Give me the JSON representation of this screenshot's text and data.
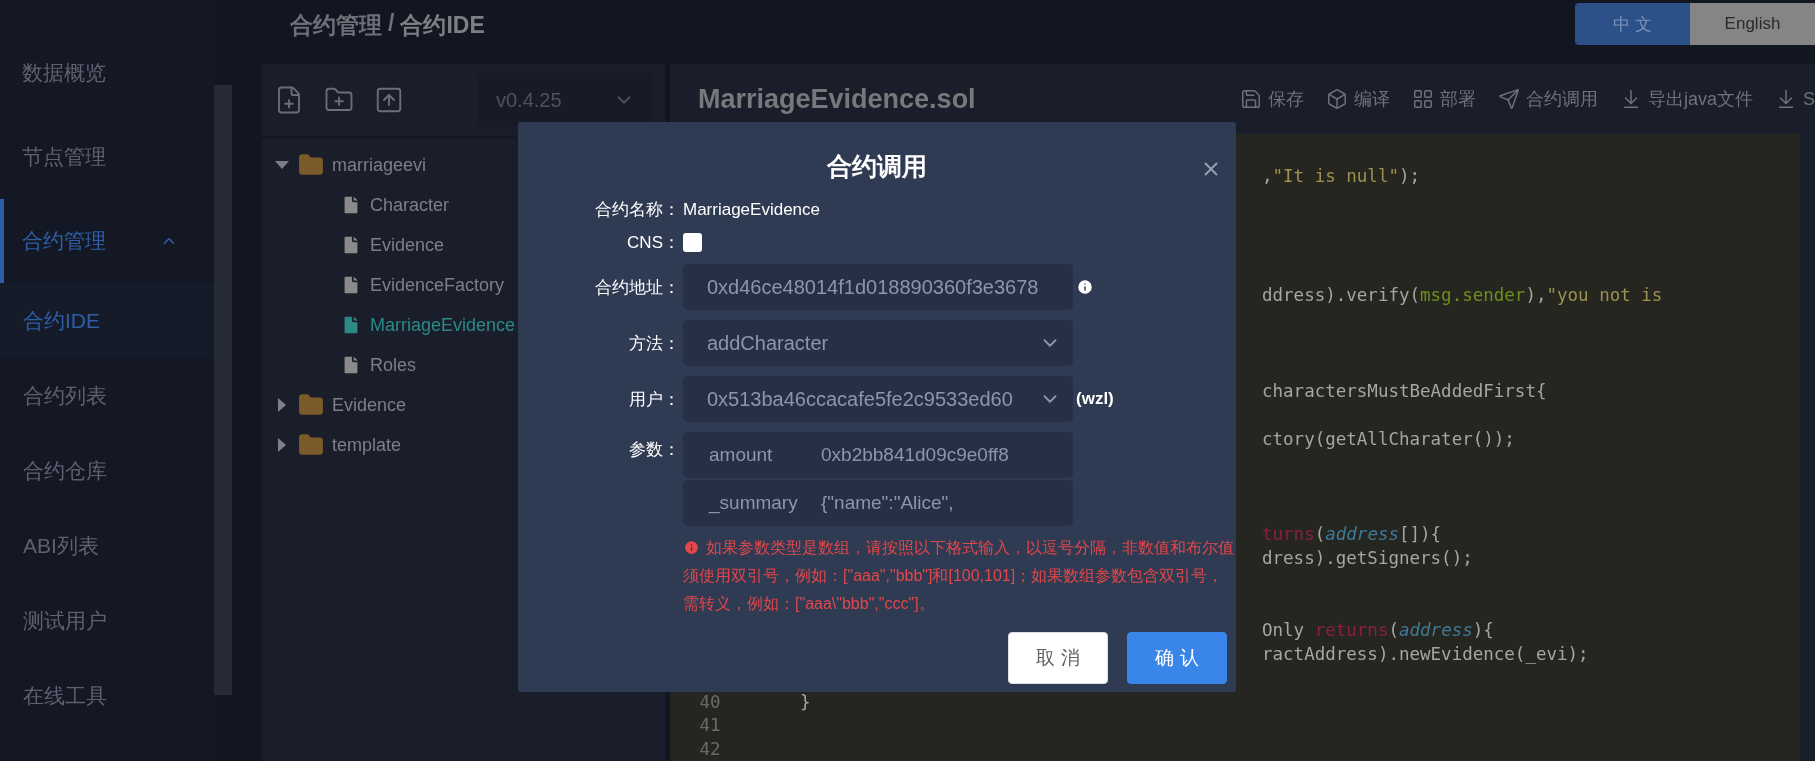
{
  "breadcrumb": {
    "parent": "合约管理",
    "separator": "/",
    "current": "合约IDE"
  },
  "language_switch": [
    {
      "label": "中 文",
      "selected": true
    },
    {
      "label": "English",
      "selected": false
    }
  ],
  "sidebar": {
    "items": [
      {
        "label": "数据概览",
        "kind": "item",
        "selected": false
      },
      {
        "label": "节点管理",
        "kind": "item",
        "selected": false
      },
      {
        "label": "合约管理",
        "kind": "group",
        "selected": true,
        "expanded": true,
        "children": [
          {
            "label": "合约IDE",
            "selected": true
          },
          {
            "label": "合约列表",
            "selected": false
          },
          {
            "label": "合约仓库",
            "selected": false
          },
          {
            "label": "ABI列表",
            "selected": false
          },
          {
            "label": "测试用户",
            "selected": false
          },
          {
            "label": "在线工具",
            "selected": false
          }
        ]
      }
    ]
  },
  "file_panel": {
    "version": "v0.4.25",
    "tree": [
      {
        "name": "marriageevi",
        "kind": "folder",
        "expanded": true,
        "selected": false,
        "children": [
          {
            "name": "Character",
            "kind": "file",
            "selected": false
          },
          {
            "name": "Evidence",
            "kind": "file",
            "selected": false
          },
          {
            "name": "EvidenceFactory",
            "kind": "file",
            "selected": false
          },
          {
            "name": "MarriageEvidence",
            "kind": "file",
            "selected": true
          },
          {
            "name": "Roles",
            "kind": "file",
            "selected": false
          }
        ]
      },
      {
        "name": "Evidence",
        "kind": "folder",
        "expanded": false,
        "selected": false
      },
      {
        "name": "template",
        "kind": "folder",
        "expanded": false,
        "selected": false
      }
    ]
  },
  "editor": {
    "title": "MarriageEvidence.sol",
    "toolbar": [
      "保存",
      "编译",
      "部署",
      "合约调用",
      "导出java文件",
      "S"
    ],
    "code_lines": [
      {
        "kind": "clipped",
        "segments": [
          {
            "kind": "plain",
            "text": ","
          },
          {
            "kind": "string",
            "text": "\"It is null\""
          },
          {
            "kind": "plain",
            "text": ");"
          }
        ]
      },
      {
        "kind": "clipped",
        "segments": [
          {
            "kind": "plain",
            "text": "ddress).verify("
          },
          {
            "kind": "var",
            "text": "msg.sender"
          },
          {
            "kind": "plain",
            "text": "),"
          },
          {
            "kind": "string",
            "text": "\"you not is"
          }
        ]
      },
      {
        "kind": "clipped",
        "segments": [
          {
            "kind": "plain",
            "text": "charactersMustBeAddedFirst{"
          }
        ]
      },
      {
        "kind": "clipped",
        "segments": [
          {
            "kind": "plain",
            "text": "ctory(getAllCharater());"
          }
        ]
      },
      {
        "kind": "clipped",
        "segments": [
          {
            "kind": "keyword",
            "text": "turns"
          },
          {
            "kind": "plain",
            "text": "("
          },
          {
            "kind": "type",
            "text": "address"
          },
          {
            "kind": "plain",
            "text": "[]){"
          }
        ]
      },
      {
        "kind": "clipped",
        "segments": [
          {
            "kind": "plain",
            "text": "dress).getSigners();"
          }
        ]
      },
      {
        "kind": "clipped",
        "segments": [
          {
            "kind": "plain",
            "text": "Only "
          },
          {
            "kind": "keyword",
            "text": "returns"
          },
          {
            "kind": "plain",
            "text": "("
          },
          {
            "kind": "type",
            "text": "address"
          },
          {
            "kind": "plain",
            "text": "){"
          }
        ]
      },
      {
        "kind": "clipped",
        "segments": [
          {
            "kind": "plain",
            "text": "ractAddress).newEvidence(_evi);"
          }
        ]
      },
      {
        "kind": "code",
        "number": "40",
        "segments": [
          {
            "kind": "plain",
            "text": "}"
          }
        ]
      },
      {
        "kind": "code",
        "number": "41"
      },
      {
        "kind": "code",
        "number": "42"
      }
    ]
  },
  "dialog": {
    "title": "合约调用",
    "contract_name": {
      "label": "合约名称：",
      "value": "MarriageEvidence"
    },
    "cns": {
      "label": "CNS：",
      "checked": false
    },
    "address": {
      "label": "合约地址：",
      "value": "0xd46ce48014f1d018890360f3e3678"
    },
    "method": {
      "label": "方法：",
      "value": "addCharacter"
    },
    "user": {
      "label": "用户：",
      "value": "0x513ba46ccacafe5fe2c9533ed60",
      "note": "(wzl)"
    },
    "params": {
      "label": "参数：",
      "items": [
        {
          "name": "amount",
          "value": "0xb2bb841d09c9e0ff8"
        },
        {
          "name": "_summary",
          "value": "{\"name\":\"Alice\","
        }
      ]
    },
    "warning": "如果参数类型是数组，请按照以下格式输入，以逗号分隔，非数值和布尔值须使用双引号，例如：[\"aaa\",\"bbb\"]和[100,101]；如果数组参数包含双引号，需转义，例如：[\"aaa\\\"bbb\",\"ccc\"]。",
    "buttons": [
      {
        "label": "取 消",
        "kind": "secondary"
      },
      {
        "label": "确 认",
        "kind": "primary"
      }
    ]
  }
}
